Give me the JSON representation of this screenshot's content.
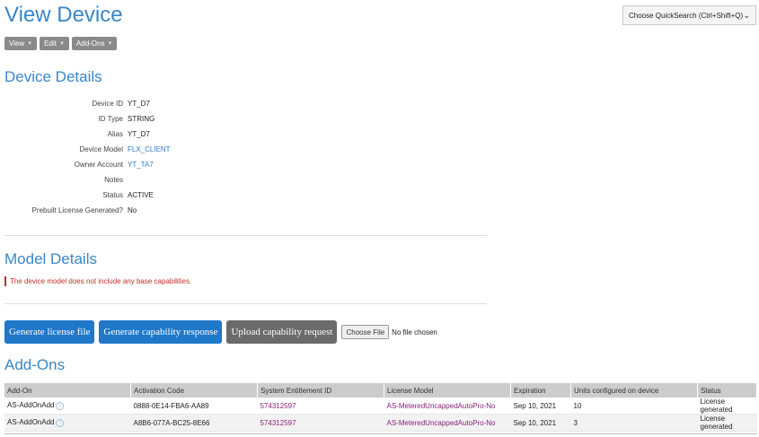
{
  "page": {
    "title": "View Device"
  },
  "quicksearch": {
    "value": "Choose QuickSearch (Ctrl+Shift+Q)"
  },
  "menu": {
    "view": "View",
    "edit": "Edit",
    "addons": "Add-Ons"
  },
  "device_details": {
    "title": "Device Details",
    "rows": [
      {
        "label": "Device ID",
        "value": "YT_D7"
      },
      {
        "label": "ID Type",
        "value": "STRING"
      },
      {
        "label": "Alias",
        "value": "YT_D7"
      },
      {
        "label": "Device Model",
        "value": "FLX_CLIENT"
      },
      {
        "label": "Owner Account",
        "value": "YT_TA7"
      },
      {
        "label": "Notes",
        "value": ""
      },
      {
        "label": "Status",
        "value": "ACTIVE"
      },
      {
        "label": "Prebuilt License Generated?",
        "value": "No"
      }
    ]
  },
  "model_details": {
    "title": "Model Details",
    "message": "The device model does not include any base capabilities."
  },
  "actions": {
    "generate_license": "Generate license file",
    "generate_capability": "Generate capability response",
    "upload_capability": "Upload capability request",
    "choose_file": "Choose File",
    "file_status": "No file chosen"
  },
  "addons": {
    "title": "Add-Ons",
    "columns": [
      "Add-On",
      "Activation Code",
      "System Entitlement ID",
      "License Model",
      "Expiration",
      "Units configured on device",
      "Status"
    ],
    "rows": [
      [
        "AS-AddOnAdd",
        "0888-0E14-FBA6-AA89",
        "574312597",
        "AS-MeteredUncappedAutoPro-No",
        "Sep 10, 2021",
        "10",
        "License generated"
      ],
      [
        "AS-AddOnAdd",
        "A8B6-077A-BC25-8E66",
        "574312597",
        "AS-MeteredUncappedAutoPro-No",
        "Sep 10, 2021",
        "3",
        "License generated"
      ]
    ]
  },
  "colors": {
    "accent": "#3a86c6",
    "button_blue": "#1f78c8",
    "button_gray": "#6b6b6b",
    "error": "#c0302a",
    "link_purple": "#8a1f7a"
  }
}
